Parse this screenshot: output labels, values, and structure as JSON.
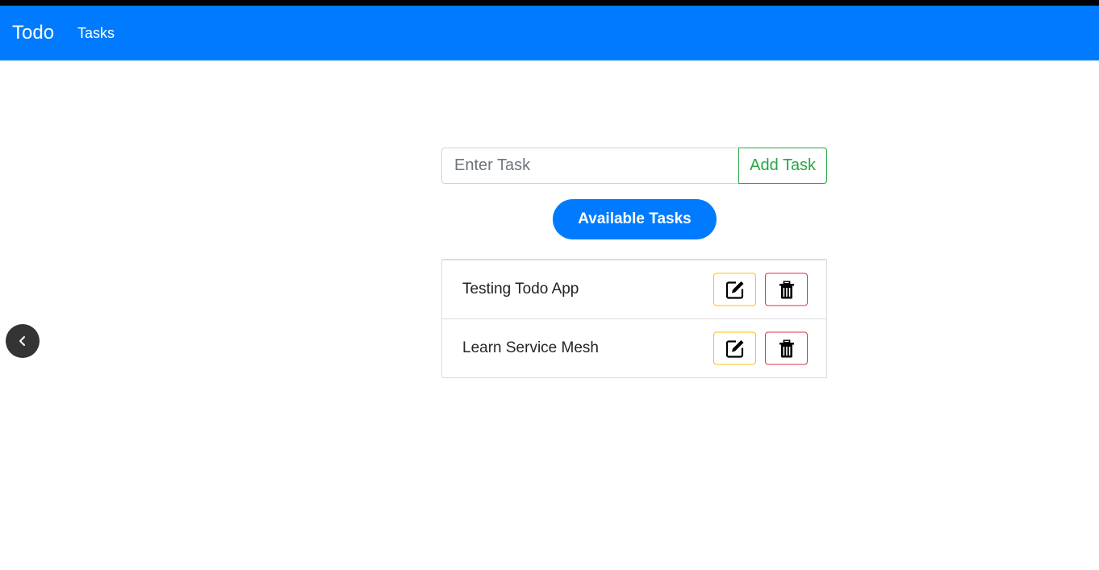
{
  "navbar": {
    "brand": "Todo",
    "links": [
      {
        "label": "Tasks"
      }
    ],
    "color": "#007bff"
  },
  "task_input": {
    "placeholder": "Enter Task",
    "value": ""
  },
  "add_button": {
    "label": "Add Task",
    "color": "#28a745"
  },
  "available_button": {
    "label": "Available Tasks"
  },
  "tasks": [
    {
      "text": "Testing Todo App",
      "edit_icon": "edit-icon",
      "delete_icon": "trash-icon"
    },
    {
      "text": "Learn Service Mesh",
      "edit_icon": "edit-icon",
      "delete_icon": "trash-icon"
    }
  ],
  "colors": {
    "edit_border": "#ffc107",
    "delete_border": "#dc3545",
    "back_button": "#343434"
  },
  "back_button": {
    "icon": "chevron-left-icon"
  }
}
